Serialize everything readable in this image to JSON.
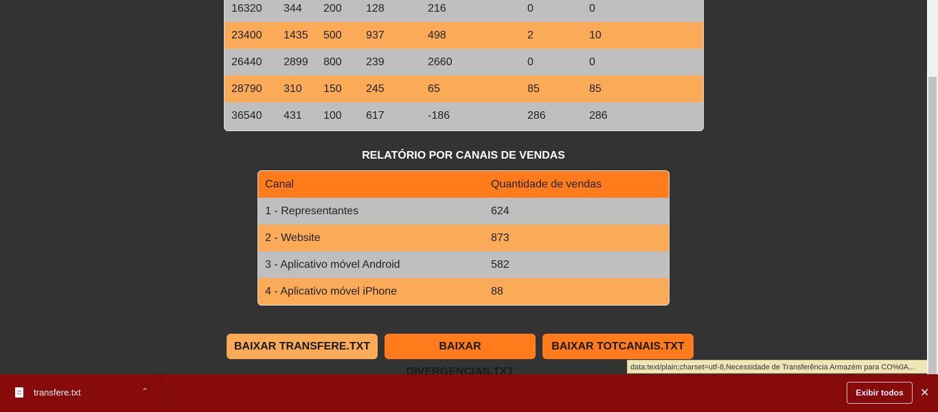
{
  "top_table": {
    "rows": [
      [
        "16320",
        "344",
        "200",
        "128",
        "216",
        "0",
        "0"
      ],
      [
        "23400",
        "1435",
        "500",
        "937",
        "498",
        "2",
        "10"
      ],
      [
        "26440",
        "2899",
        "800",
        "239",
        "2660",
        "0",
        "0"
      ],
      [
        "28790",
        "310",
        "150",
        "245",
        "65",
        "85",
        "85"
      ],
      [
        "36540",
        "431",
        "100",
        "617",
        "-186",
        "286",
        "286"
      ]
    ]
  },
  "channels": {
    "title": "RELATÓRIO POR CANAIS DE VENDAS",
    "headers": [
      "Canal",
      "Quantidade de vendas"
    ],
    "rows": [
      [
        "1 - Representantes",
        "624"
      ],
      [
        "2 - Website",
        "873"
      ],
      [
        "3 - Aplicativo móvel Android",
        "582"
      ],
      [
        "4 - Aplicativo móvel iPhone",
        "88"
      ]
    ]
  },
  "buttons": {
    "transfere": "BAIXAR TRANSFERE.TXT",
    "divergencias": "BAIXAR DIVERGENCIAS.TXT",
    "totcanais": "BAIXAR TOTCANAIS.TXT"
  },
  "status_url": "data:text/plain;charset=utf-8,Necessidade de Transferência Armazém para CO%0A...",
  "download_bar": {
    "file_name": "transfere.txt",
    "show_all": "Exibir todos",
    "icons": [
      "file-icon",
      "chevron-up-icon",
      "close-icon"
    ]
  },
  "colors": {
    "background": "#333333",
    "row_gray": "#bfbfbf",
    "row_orange": "#fbab58",
    "accent_orange": "#ff7b1c",
    "download_bar": "#880b0b"
  }
}
